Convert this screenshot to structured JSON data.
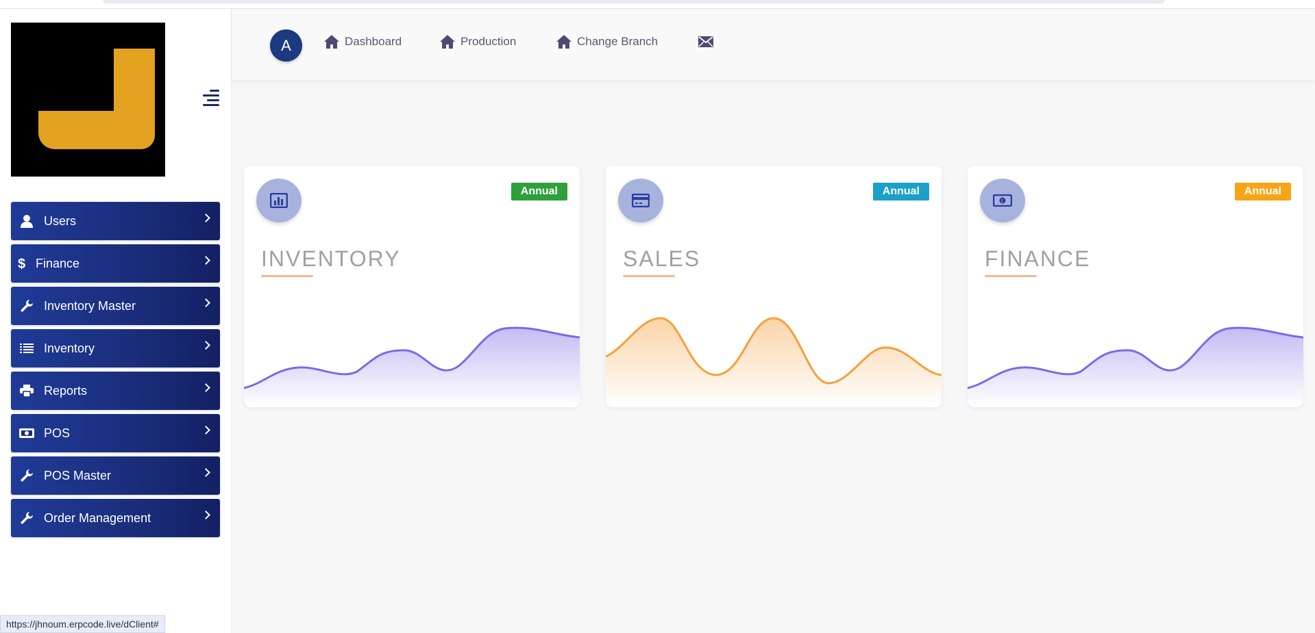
{
  "sidebar": {
    "logo_letter": "J",
    "menu": [
      {
        "label": "Users",
        "icon": "user-icon"
      },
      {
        "label": "Finance",
        "icon": "dollar-icon"
      },
      {
        "label": "Inventory Master",
        "icon": "wrench-icon"
      },
      {
        "label": "Inventory",
        "icon": "list-icon"
      },
      {
        "label": "Reports",
        "icon": "printer-icon"
      },
      {
        "label": "POS",
        "icon": "money-bill-icon"
      },
      {
        "label": "POS Master",
        "icon": "wrench-icon"
      },
      {
        "label": "Order Management",
        "icon": "wrench-icon"
      }
    ]
  },
  "topnav": {
    "avatar_initial": "A",
    "links": [
      {
        "label": "Dashboard",
        "icon": "home-icon"
      },
      {
        "label": "Production",
        "icon": "home-icon"
      },
      {
        "label": "Change Branch",
        "icon": "home-icon"
      },
      {
        "label": "",
        "icon": "envelope-icon"
      }
    ]
  },
  "cards": [
    {
      "title": "INVENTORY",
      "badge": "Annual",
      "badge_color": "#2ea03a",
      "icon": "bar-chart-icon",
      "wave_color": "#7b6ae6"
    },
    {
      "title": "SALES",
      "badge": "Annual",
      "badge_color": "#1ba0c9",
      "icon": "credit-card-icon",
      "wave_color": "#f4a03c"
    },
    {
      "title": "FINANCE",
      "badge": "Annual",
      "badge_color": "#f7a416",
      "icon": "money-bill-icon",
      "wave_color": "#7b6ae6"
    }
  ],
  "status_url": "https://jhnoum.erpcode.live/dClient#"
}
